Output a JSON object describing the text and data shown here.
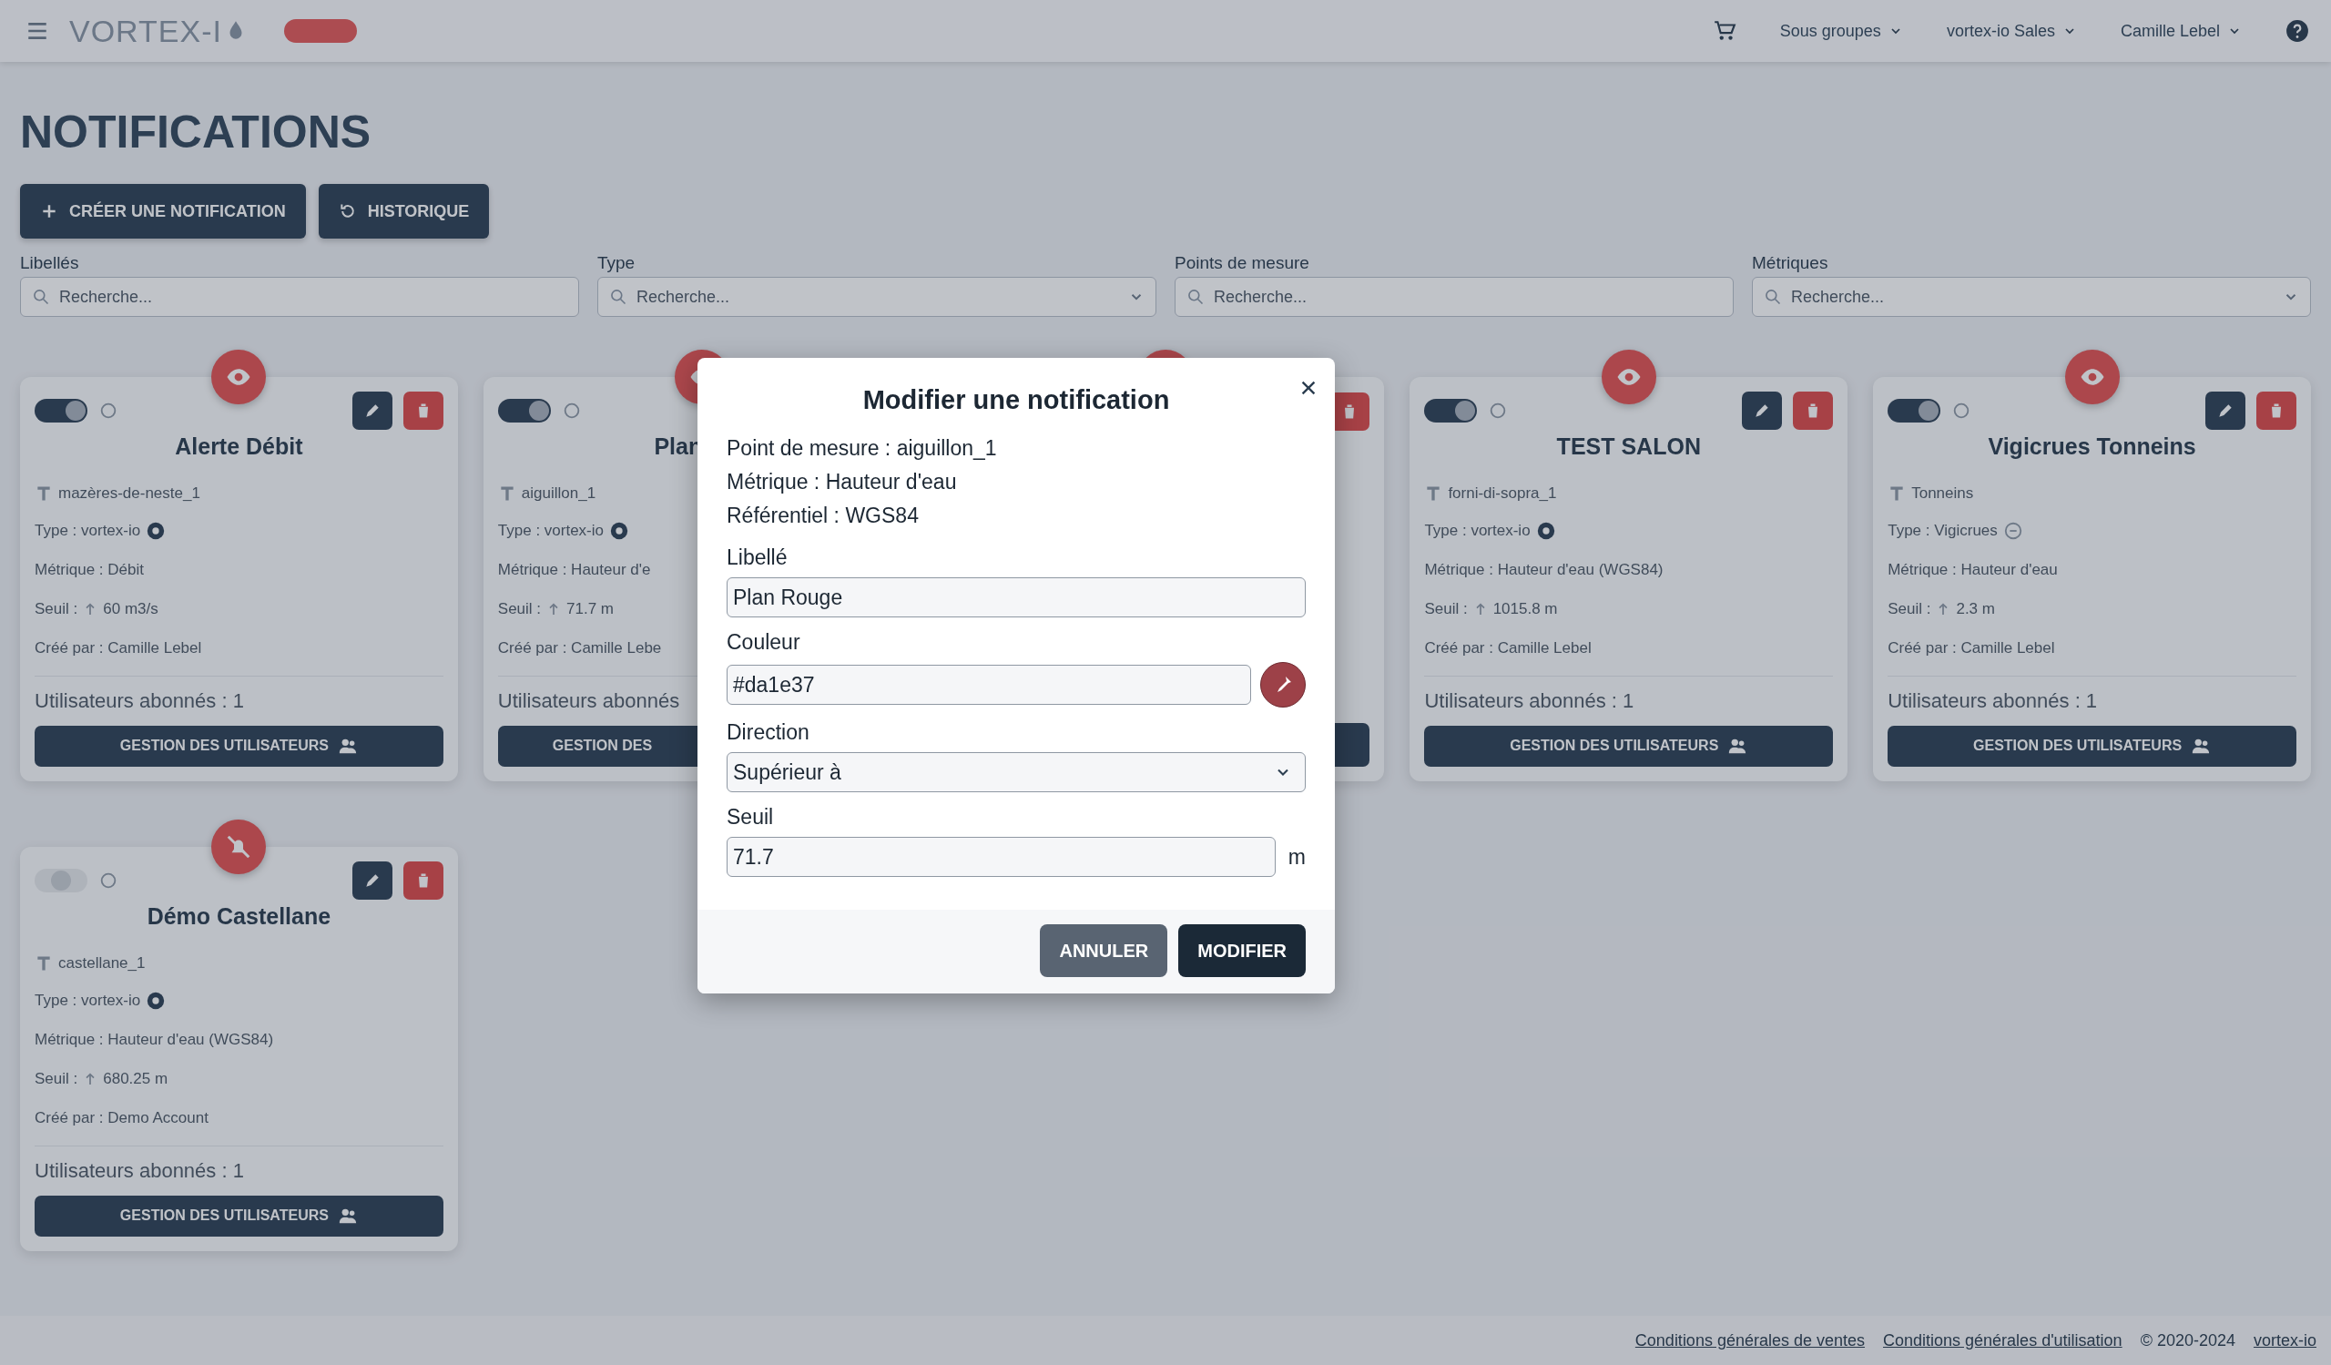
{
  "topbar": {
    "logo": "VORTEX-I",
    "menus": [
      {
        "label": "Sous groupes"
      },
      {
        "label": "vortex-io Sales"
      },
      {
        "label": "Camille Lebel"
      }
    ]
  },
  "page_title": "NOTIFICATIONS",
  "actions": [
    {
      "label": "CRÉER UNE NOTIFICATION",
      "kind": "create"
    },
    {
      "label": "HISTORIQUE",
      "kind": "history"
    }
  ],
  "filters": [
    {
      "label": "Libellés",
      "placeholder": "Recherche...",
      "dropdown": false
    },
    {
      "label": "Type",
      "placeholder": "Recherche...",
      "dropdown": true
    },
    {
      "label": "Points de mesure",
      "placeholder": "Recherche...",
      "dropdown": false
    },
    {
      "label": "Métriques",
      "placeholder": "Recherche...",
      "dropdown": true
    }
  ],
  "cards": [
    {
      "kind": "full",
      "enabled": true,
      "muted": false,
      "title": "Alerte Débit",
      "station": "mazères-de-neste_1",
      "type": "Type : vortex-io",
      "type_badge_filled": true,
      "metric": "Métrique : Débit",
      "threshold_label": "Seuil :",
      "threshold": "60 m3/s",
      "author": "Créé par : Camille Lebel",
      "subscribers": "Utilisateurs abonnés : 1",
      "button": "GESTION DES UTILISATEURS"
    },
    {
      "kind": "partial",
      "enabled": true,
      "muted": false,
      "title": "Plan",
      "station": "aiguillon_1",
      "type": "Type : vortex-io",
      "type_badge_filled": true,
      "metric": "Métrique : Hauteur d'e",
      "threshold_label": "Seuil :",
      "threshold": "71.7 m",
      "author": "Créé par : Camille Lebe",
      "subscribers": "Utilisateurs abonnés",
      "button": "GESTION DES"
    },
    {
      "kind": "hidden"
    },
    {
      "kind": "full",
      "enabled": true,
      "muted": false,
      "title": "TEST SALON",
      "station": "forni-di-sopra_1",
      "type": "Type : vortex-io",
      "type_badge_filled": true,
      "metric": "Métrique : Hauteur d'eau (WGS84)",
      "threshold_label": "Seuil :",
      "threshold": "1015.8 m",
      "author": "Créé par : Camille Lebel",
      "subscribers": "Utilisateurs abonnés : 1",
      "button": "GESTION DES UTILISATEURS"
    },
    {
      "kind": "full",
      "enabled": true,
      "muted": false,
      "title": "Vigicrues Tonneins",
      "station": "Tonneins",
      "type": "Type : Vigicrues",
      "type_badge_filled": false,
      "metric": "Métrique : Hauteur d'eau",
      "threshold_label": "Seuil :",
      "threshold": "2.3 m",
      "author": "Créé par : Camille Lebel",
      "subscribers": "Utilisateurs abonnés : 1",
      "button": "GESTION DES UTILISATEURS"
    },
    {
      "kind": "full",
      "enabled": false,
      "muted": true,
      "title": "Démo Castellane",
      "station": "castellane_1",
      "type": "Type : vortex-io",
      "type_badge_filled": true,
      "metric": "Métrique : Hauteur d'eau (WGS84)",
      "threshold_label": "Seuil :",
      "threshold": "680.25 m",
      "author": "Créé par : Demo Account",
      "subscribers": "Utilisateurs abonnés : 1",
      "button": "GESTION DES UTILISATEURS"
    }
  ],
  "footer": {
    "links": [
      "Conditions générales de ventes",
      "Conditions générales d'utilisation"
    ],
    "copyright": "© 2020-2024",
    "brand_link": "vortex-io"
  },
  "dialog": {
    "title": "Modifier une notification",
    "info": [
      "Point de mesure : aiguillon_1",
      "Métrique : Hauteur d'eau",
      "Référentiel : WGS84"
    ],
    "fields": [
      {
        "kind": "text",
        "label": "Libellé",
        "value": "Plan Rouge"
      },
      {
        "kind": "color",
        "label": "Couleur",
        "value": "#da1e37"
      },
      {
        "kind": "select",
        "label": "Direction",
        "value": "Supérieur à"
      },
      {
        "kind": "number",
        "label": "Seuil",
        "value": "71.7",
        "unit": "m"
      }
    ],
    "buttons": [
      {
        "label": "ANNULER",
        "kind": "secondary"
      },
      {
        "label": "MODIFIER",
        "kind": "primary"
      }
    ]
  }
}
